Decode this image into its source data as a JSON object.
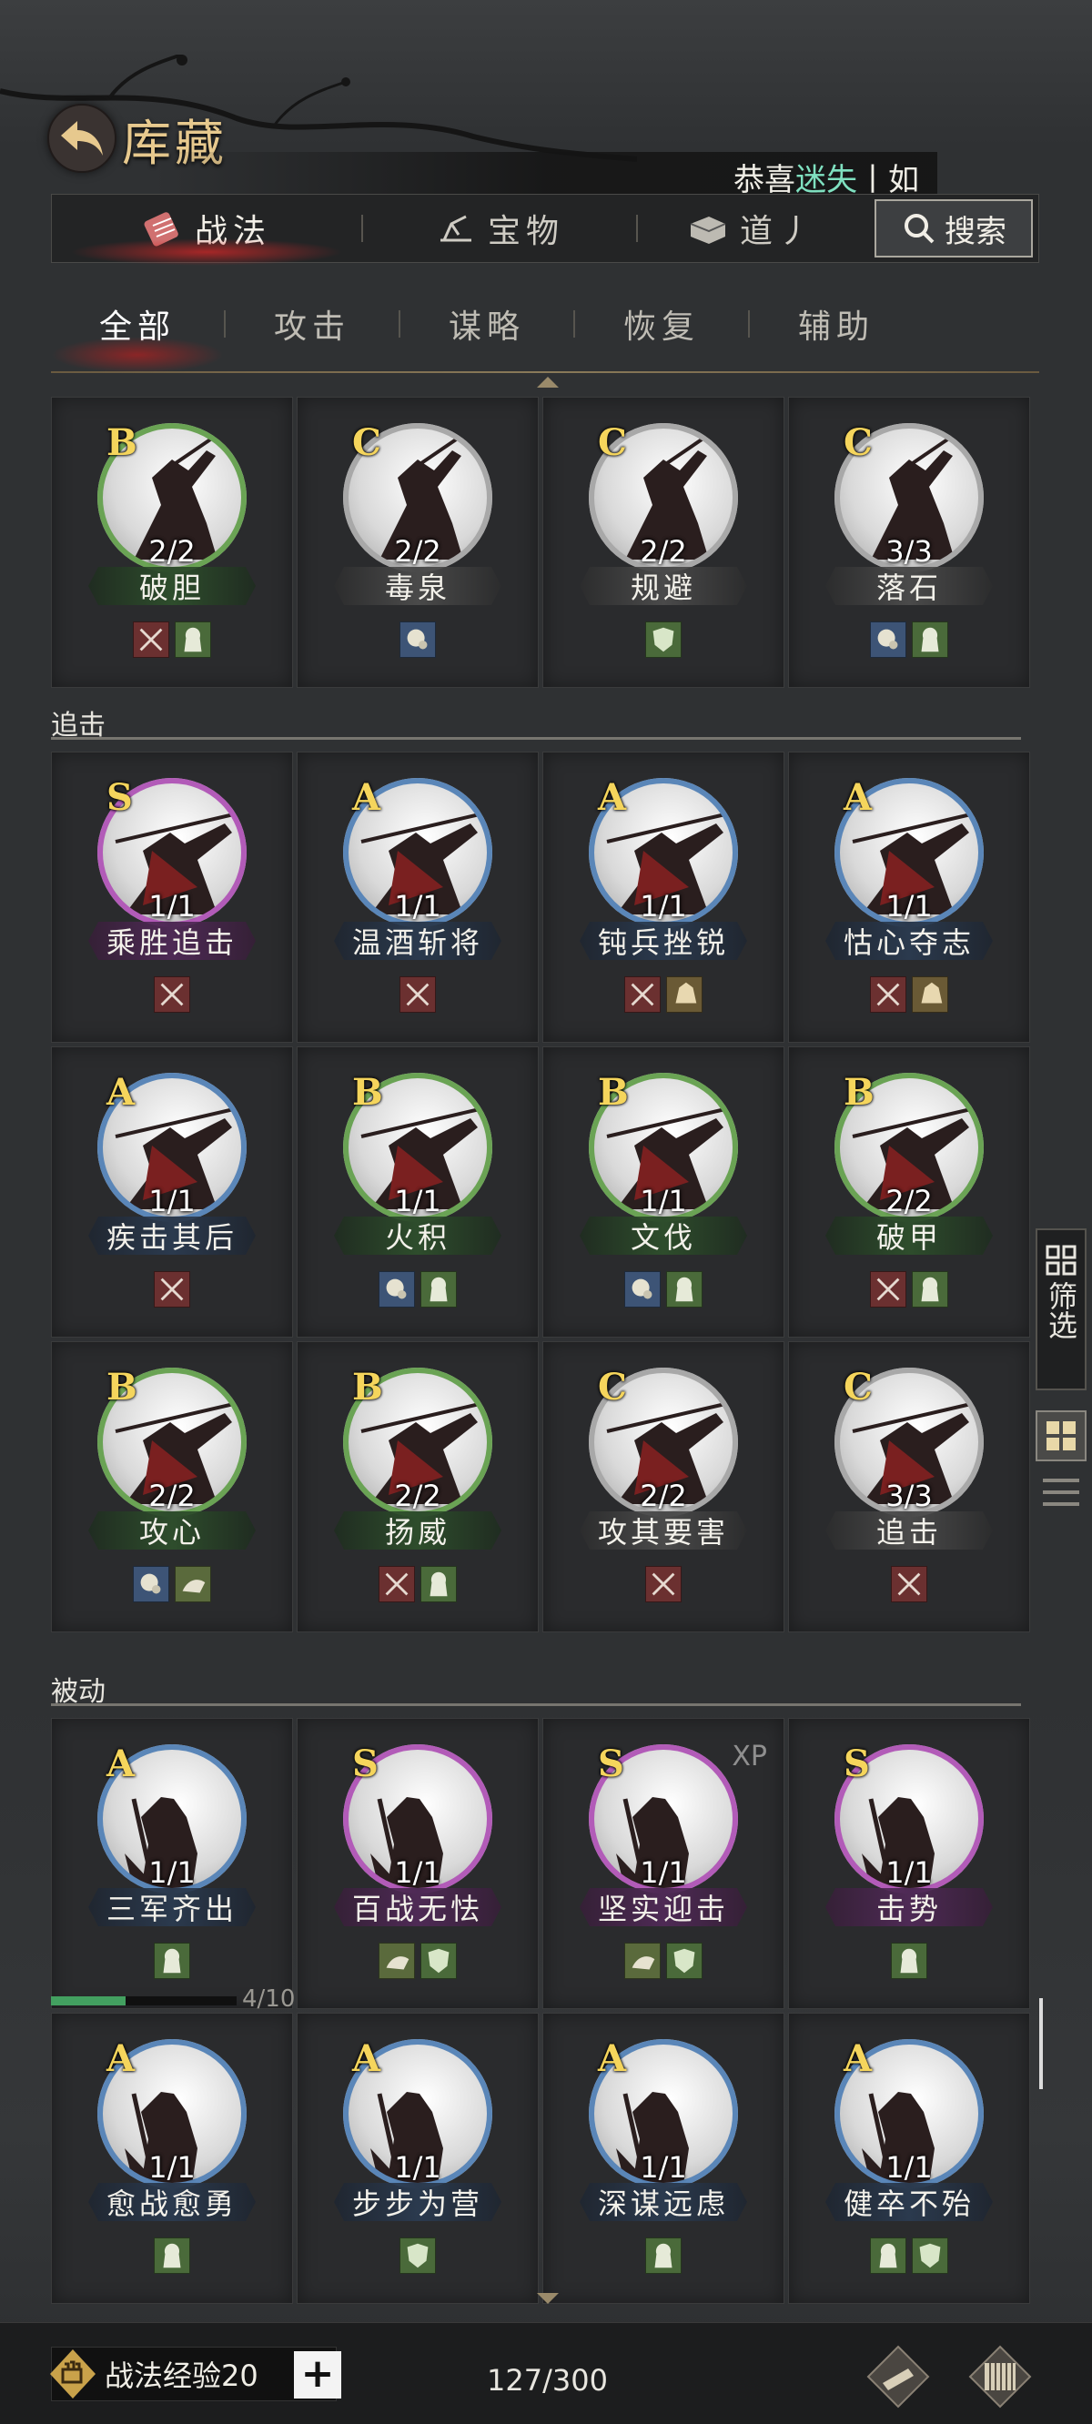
{
  "header": {
    "title": "库藏"
  },
  "ticker": {
    "prefix": "恭喜",
    "name": "迷失",
    "suffix": "丨如"
  },
  "tabs": [
    {
      "label": "战法"
    },
    {
      "label": "宝物"
    },
    {
      "label": "道丿"
    }
  ],
  "search": {
    "label": "搜索"
  },
  "subtabs": [
    {
      "label": "全部"
    },
    {
      "label": "攻击"
    },
    {
      "label": "谋略"
    },
    {
      "label": "恢复"
    },
    {
      "label": "辅助"
    }
  ],
  "sections": {
    "chase": "追击",
    "passive": "被动"
  },
  "group0": [
    {
      "grade": "B",
      "count": "2/2",
      "name": "破胆",
      "tags": [
        "atk",
        "def"
      ]
    },
    {
      "grade": "C",
      "count": "2/2",
      "name": "毒泉",
      "tags": [
        "int"
      ]
    },
    {
      "grade": "C",
      "count": "2/2",
      "name": "规避",
      "tags": [
        "shield"
      ]
    },
    {
      "grade": "C",
      "count": "3/3",
      "name": "落石",
      "tags": [
        "int",
        "def"
      ]
    }
  ],
  "group1": [
    {
      "grade": "S",
      "count": "1/1",
      "name": "乘胜追击",
      "tags": [
        "atk"
      ]
    },
    {
      "grade": "A",
      "count": "1/1",
      "name": "温酒斩将",
      "tags": [
        "atk"
      ]
    },
    {
      "grade": "A",
      "count": "1/1",
      "name": "钝兵挫锐",
      "tags": [
        "atk",
        "horse"
      ]
    },
    {
      "grade": "A",
      "count": "1/1",
      "name": "怙心夺志",
      "tags": [
        "atk",
        "horse"
      ]
    },
    {
      "grade": "A",
      "count": "1/1",
      "name": "疾击其后",
      "tags": [
        "atk"
      ]
    },
    {
      "grade": "B",
      "count": "1/1",
      "name": "火积",
      "tags": [
        "int",
        "def"
      ]
    },
    {
      "grade": "B",
      "count": "1/1",
      "name": "文伐",
      "tags": [
        "int",
        "def"
      ]
    },
    {
      "grade": "B",
      "count": "2/2",
      "name": "破甲",
      "tags": [
        "atk",
        "def"
      ]
    },
    {
      "grade": "B",
      "count": "2/2",
      "name": "攻心",
      "tags": [
        "int",
        "spd"
      ]
    },
    {
      "grade": "B",
      "count": "2/2",
      "name": "扬威",
      "tags": [
        "atk",
        "def"
      ]
    },
    {
      "grade": "C",
      "count": "2/2",
      "name": "攻其要害",
      "tags": [
        "atk"
      ]
    },
    {
      "grade": "C",
      "count": "3/3",
      "name": "追击",
      "tags": [
        "atk"
      ]
    }
  ],
  "group2": [
    {
      "grade": "A",
      "count": "1/1",
      "name": "三军齐出",
      "tags": [
        "def"
      ]
    },
    {
      "grade": "S",
      "count": "1/1",
      "name": "百战无怯",
      "tags": [
        "spd",
        "shield"
      ]
    },
    {
      "grade": "S",
      "count": "1/1",
      "name": "坚实迎击",
      "tags": [
        "spd",
        "shield"
      ],
      "xp": "XP"
    },
    {
      "grade": "S",
      "count": "1/1",
      "name": "击势",
      "tags": [
        "def"
      ]
    },
    {
      "grade": "A",
      "count": "1/1",
      "name": "愈战愈勇",
      "tags": [
        "def"
      ]
    },
    {
      "grade": "A",
      "count": "1/1",
      "name": "步步为营",
      "tags": [
        "shield"
      ]
    },
    {
      "grade": "A",
      "count": "1/1",
      "name": "深谋远虑",
      "tags": [
        "def"
      ]
    },
    {
      "grade": "A",
      "count": "1/1",
      "name": "健卒不殆",
      "tags": [
        "def",
        "shield"
      ]
    }
  ],
  "progress": {
    "value": 0.4,
    "text": "4/10"
  },
  "side": {
    "filter": "筛选"
  },
  "footer": {
    "xp_label": "战法经验20",
    "plus": "+",
    "capacity": "127/300"
  }
}
